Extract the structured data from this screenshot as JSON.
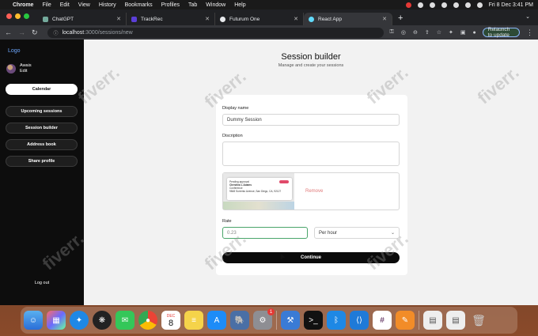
{
  "menubar": {
    "app": "Chrome",
    "items": [
      "File",
      "Edit",
      "View",
      "History",
      "Bookmarks",
      "Profiles",
      "Tab",
      "Window",
      "Help"
    ],
    "datetime": "Fri 8 Dec  3:41 PM"
  },
  "tabs": [
    {
      "title": "ChatGPT",
      "color": "#74aa9c"
    },
    {
      "title": "TrackRec",
      "color": "#5b3fd8"
    },
    {
      "title": "Futurum One",
      "color": "#e8eaed"
    },
    {
      "title": "React App",
      "color": "#61dafb"
    }
  ],
  "url": {
    "host": "localhost",
    "path": ":3000/sessions/new"
  },
  "relaunch_label": "Relaunch to update",
  "sidebar": {
    "logo": "Logo",
    "user_name": "Awais",
    "user_edit": "Edit",
    "items": [
      "Calendar",
      "Upcoming sessions",
      "Session builder",
      "Address book",
      "Share profile"
    ],
    "logout": "Log out"
  },
  "page": {
    "title": "Session builder",
    "subtitle": "Manage and create your sessions"
  },
  "form": {
    "display_name_label": "Display name",
    "display_name_value": "Dummy Session",
    "description_label": "Discription",
    "description_value": "",
    "remove_label": "Remove",
    "rate_label": "Rate",
    "rate_value": "0.23",
    "rate_unit": "Per hour",
    "continue_label": "Continue"
  },
  "thumbnail": {
    "line1": "Pending approval",
    "line2": "Christina L Adams",
    "line3": "Conference",
    "line4": "9848 Sorrento Avenue, San Diego, CA, 92127"
  },
  "watermark": "fiverr.",
  "dock": {
    "calendar_month": "DEC",
    "calendar_day": "8",
    "settings_badge": "1"
  }
}
